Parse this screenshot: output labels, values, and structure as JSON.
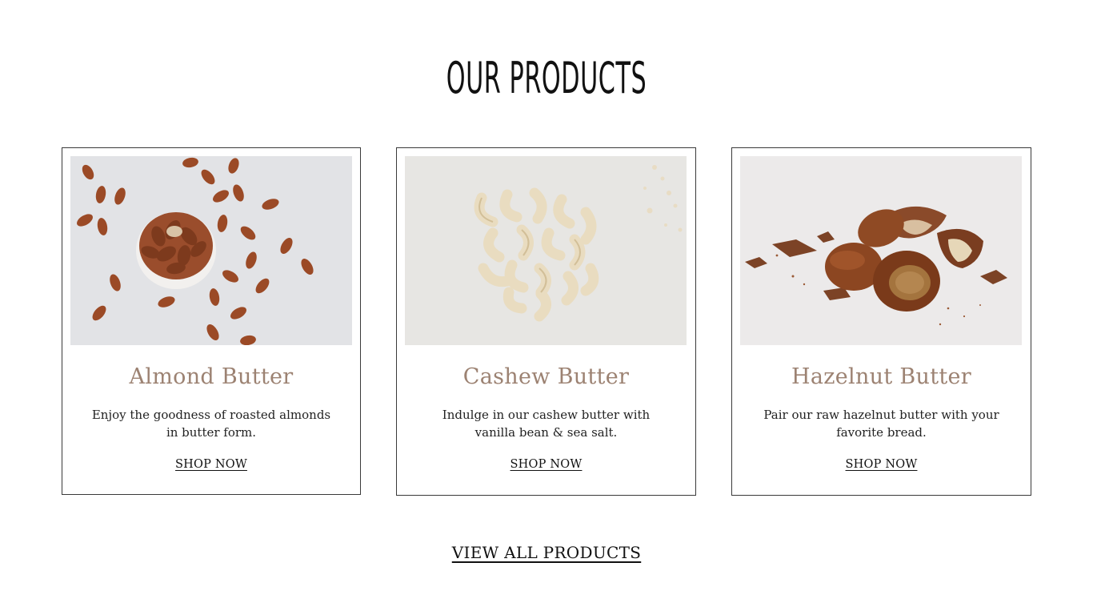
{
  "section": {
    "title": "OUR PRODUCTS"
  },
  "products": [
    {
      "name": "Almond Butter",
      "description": "Enjoy the goodness of roasted almonds in butter form.",
      "link_label": "SHOP NOW",
      "image_icon": "almonds-photo"
    },
    {
      "name": "Cashew Butter",
      "description": "Indulge in our cashew butter with vanilla bean & sea salt.",
      "link_label": "SHOP NOW",
      "image_icon": "cashews-photo"
    },
    {
      "name": "Hazelnut Butter",
      "description": "Pair our raw hazelnut butter with your favorite bread.",
      "link_label": "SHOP NOW",
      "image_icon": "hazelnuts-photo"
    }
  ],
  "footer": {
    "view_all_label": "VIEW ALL PRODUCTS"
  },
  "colors": {
    "title_accent": "#9c8272",
    "border": "#3a3a3a",
    "text": "#111111"
  }
}
